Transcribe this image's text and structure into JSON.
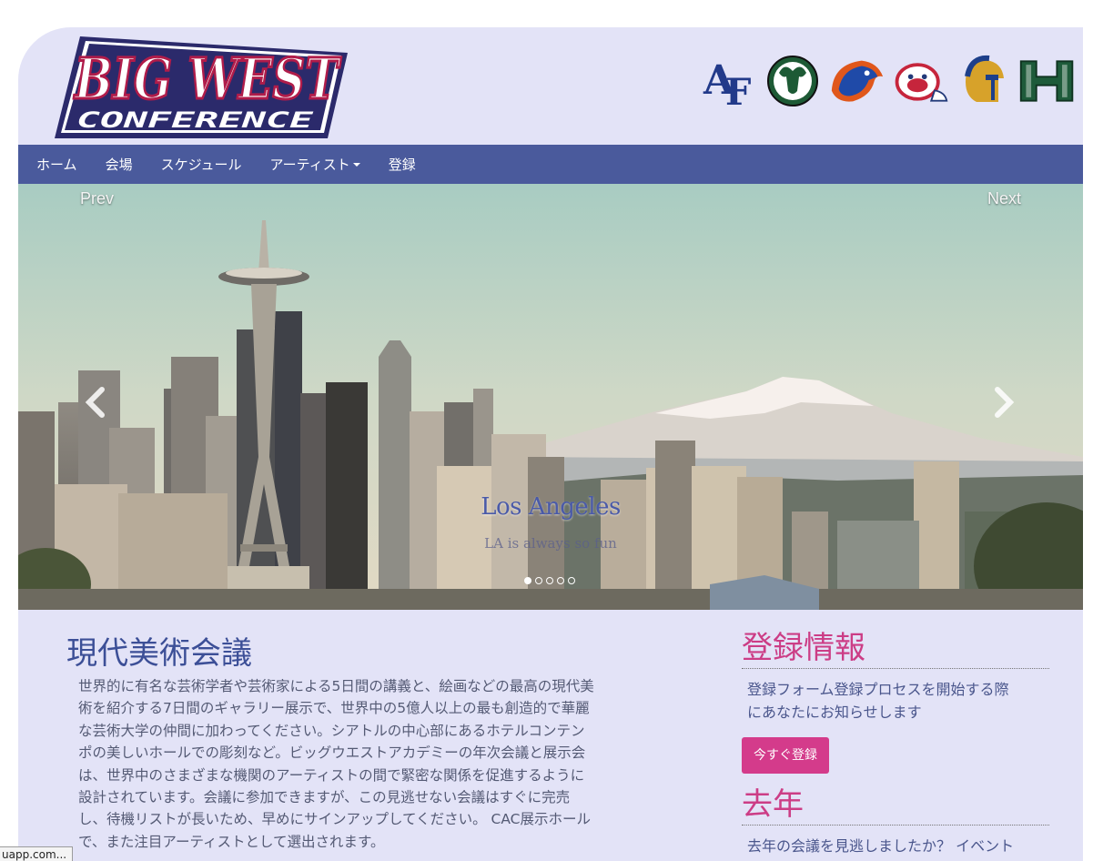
{
  "brand": {
    "logo_line1": "BIG WEST",
    "logo_line2": "CONFERENCE",
    "teams": [
      "air-force-logo",
      "colorado-state-ram-logo",
      "boise-state-bronco-logo",
      "fresno-state-bulldog-logo",
      "san-jose-state-spartan-logo",
      "hawaii-logo"
    ]
  },
  "nav": {
    "home": "ホーム",
    "venue": "会場",
    "schedule": "スケジュール",
    "artists": "アーティスト",
    "register": "登録"
  },
  "carousel": {
    "prev": "Prev",
    "next": "Next",
    "caption_title": "Los Angeles",
    "caption_sub": "LA is always so fun",
    "slide_count": 5,
    "active_slide": 1
  },
  "main": {
    "title": "現代美術会議",
    "body_lines": [
      "世界的に有名な芸術学者や芸術家による5日間の講義と、絵画などの最高の現代美",
      "術を紹介する7日間のギャラリー展示で、世界中の5億人以上の最も創造的で華麗",
      "な芸術大学の仲間に加わってください。シアトルの中心部にあるホテルコンテン",
      "ポの美しいホールでの彫刻など。ビッグウエストアカデミーの年次会議と展示会",
      "は、世界中のさまざまな機関のアーティストの間で緊密な関係を促進するように",
      "設計されています。会議に参加できますが、この見逃せない会議はすぐに完売",
      "し、待機リストが長いため、早めにサインアップしてください。 CAC展示ホール",
      "で、また注目アーティストとして選出されます。"
    ]
  },
  "sidebar": {
    "registration_heading": "登録情報",
    "registration_text_line1": "登録フォーム登録プロセスを開始する際",
    "registration_text_line2": "にあなたにお知らせします",
    "register_button": "今すぐ登録",
    "last_year_heading": "去年",
    "last_year_text": "去年の会議を見逃しましたか？ イベント"
  },
  "status_tooltip": "uapp.com..."
}
